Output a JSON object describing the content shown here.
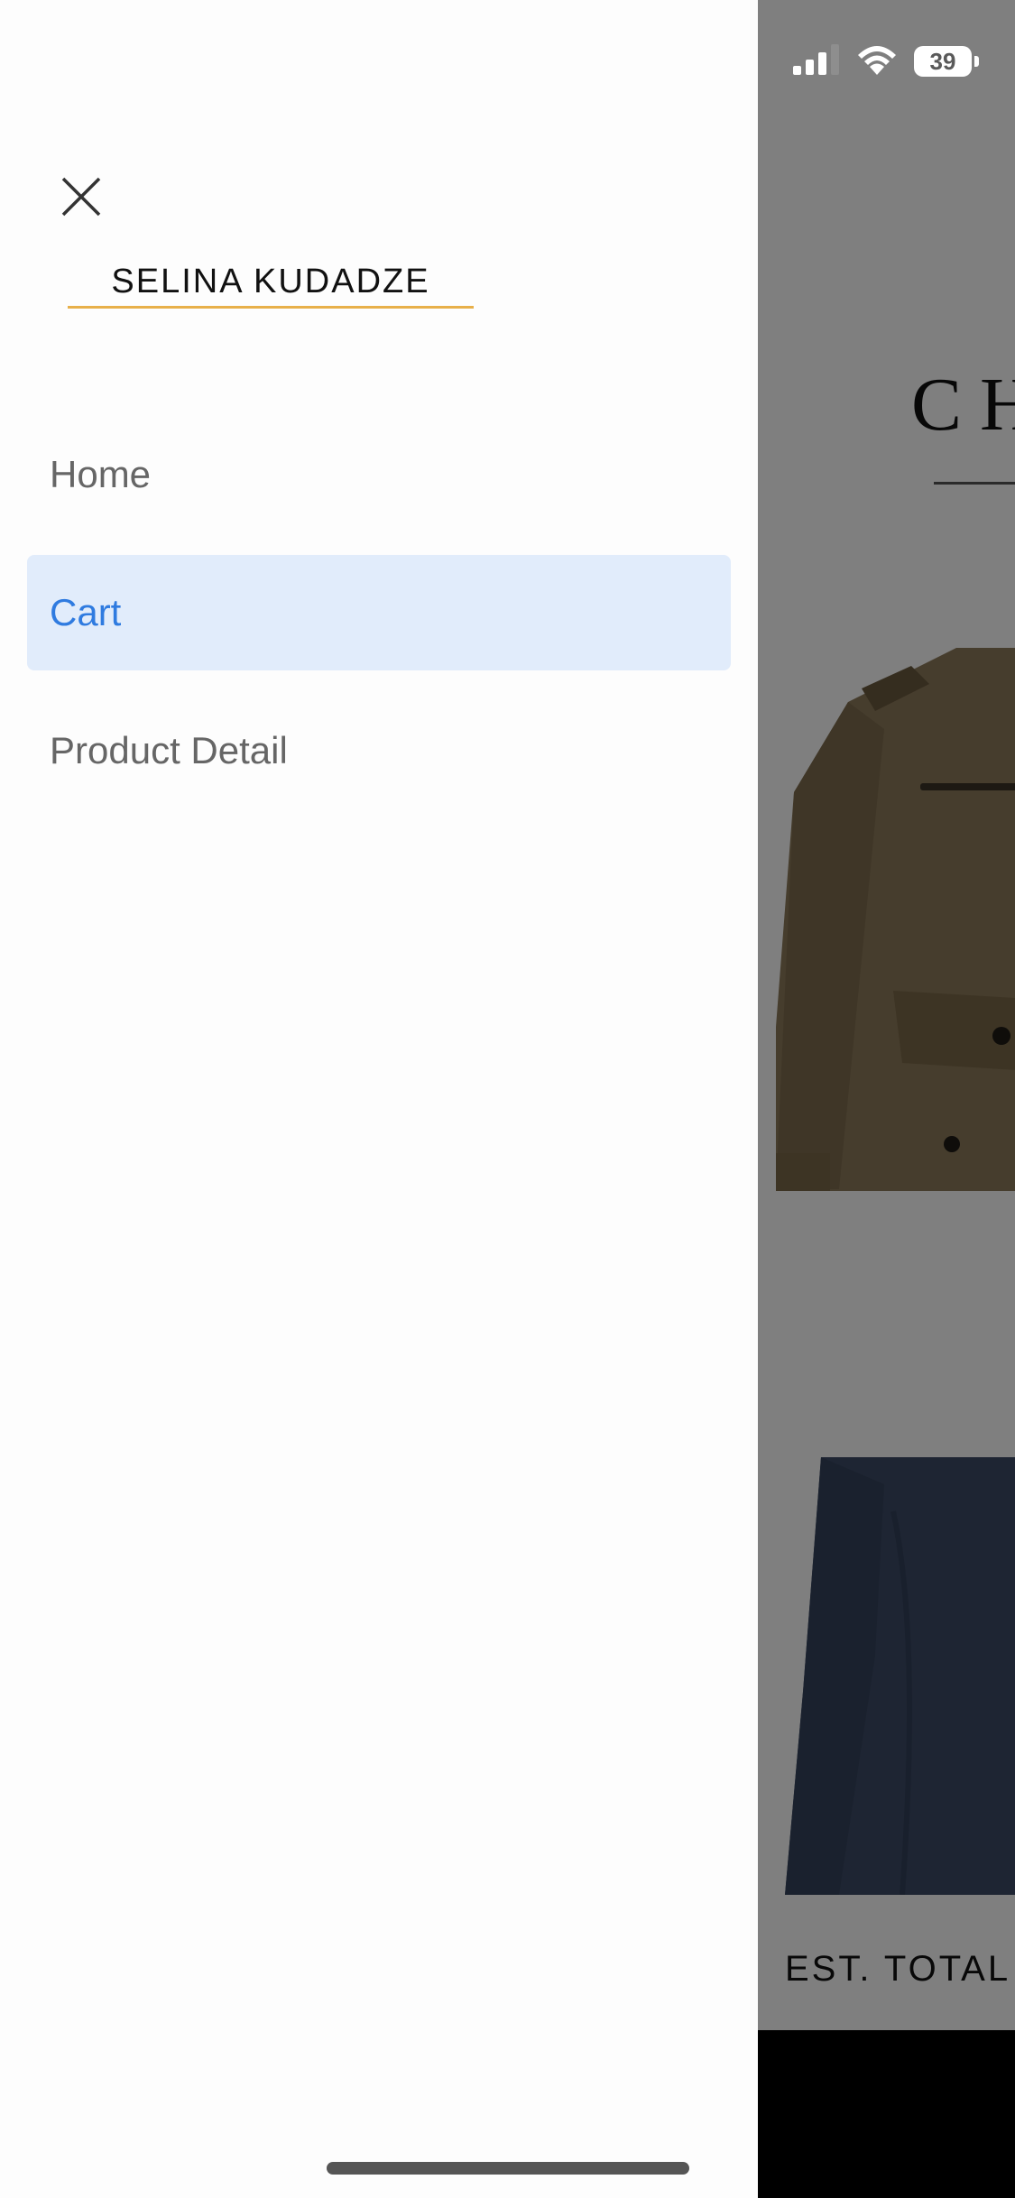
{
  "status_bar": {
    "battery": "39"
  },
  "background_screen": {
    "title_fragment": "CH",
    "est_total_label": "EST. TOTAL"
  },
  "drawer": {
    "user_name": "SELINA KUDADZE",
    "menu": [
      {
        "label": "Home",
        "active": false
      },
      {
        "label": "Cart",
        "active": true
      },
      {
        "label": "Product Detail",
        "active": false
      }
    ]
  },
  "colors": {
    "accent": "#2f7be0",
    "active_bg": "#e1ecfb",
    "underline": "#e8b04a"
  },
  "icons": [
    "close-icon",
    "signal-icon",
    "wifi-icon",
    "battery-icon"
  ]
}
